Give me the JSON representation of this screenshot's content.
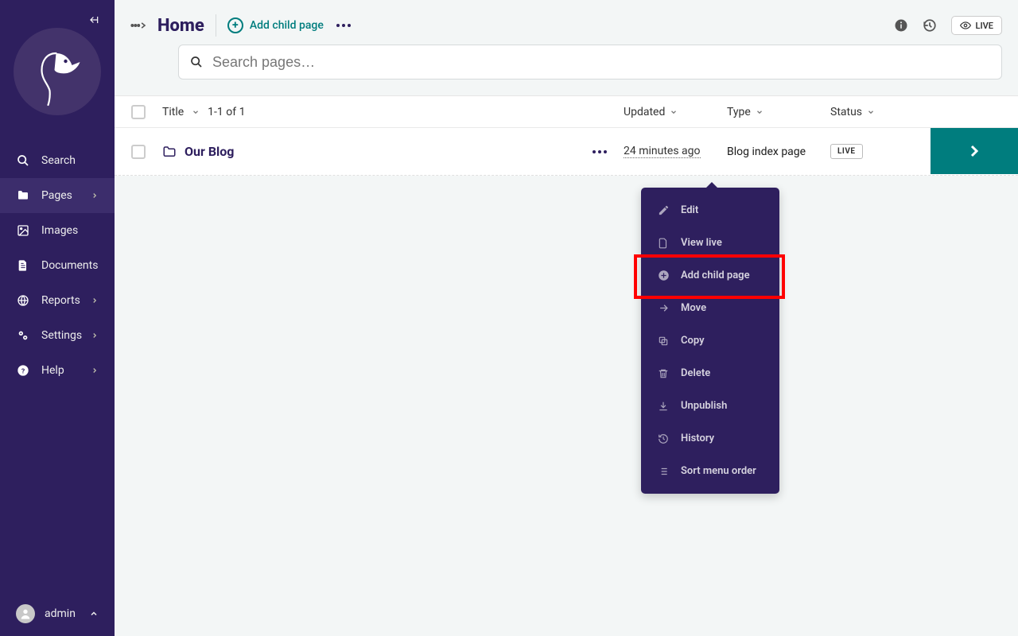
{
  "sidebar": {
    "items": [
      {
        "label": "Search"
      },
      {
        "label": "Pages"
      },
      {
        "label": "Images"
      },
      {
        "label": "Documents"
      },
      {
        "label": "Reports"
      },
      {
        "label": "Settings"
      },
      {
        "label": "Help"
      }
    ],
    "user": "admin"
  },
  "header": {
    "title": "Home",
    "add_child_label": "Add child page",
    "live_label": "LIVE"
  },
  "search": {
    "placeholder": "Search pages…"
  },
  "table": {
    "columns": {
      "title": "Title",
      "pager": "1-1 of 1",
      "updated": "Updated",
      "type": "Type",
      "status": "Status"
    },
    "rows": [
      {
        "name": "Our Blog",
        "updated": "24 minutes ago",
        "type": "Blog index page",
        "status": "LIVE"
      }
    ]
  },
  "context_menu": {
    "items": [
      {
        "label": "Edit"
      },
      {
        "label": "View live"
      },
      {
        "label": "Add child page"
      },
      {
        "label": "Move"
      },
      {
        "label": "Copy"
      },
      {
        "label": "Delete"
      },
      {
        "label": "Unpublish"
      },
      {
        "label": "History"
      },
      {
        "label": "Sort menu order"
      }
    ]
  }
}
